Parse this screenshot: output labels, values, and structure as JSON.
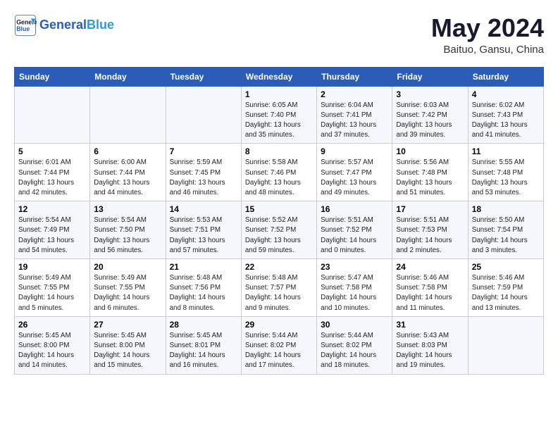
{
  "header": {
    "logo_line1": "General",
    "logo_line2": "Blue",
    "month": "May 2024",
    "location": "Baituo, Gansu, China"
  },
  "weekdays": [
    "Sunday",
    "Monday",
    "Tuesday",
    "Wednesday",
    "Thursday",
    "Friday",
    "Saturday"
  ],
  "weeks": [
    [
      {
        "day": "",
        "info": ""
      },
      {
        "day": "",
        "info": ""
      },
      {
        "day": "",
        "info": ""
      },
      {
        "day": "1",
        "info": "Sunrise: 6:05 AM\nSunset: 7:40 PM\nDaylight: 13 hours\nand 35 minutes."
      },
      {
        "day": "2",
        "info": "Sunrise: 6:04 AM\nSunset: 7:41 PM\nDaylight: 13 hours\nand 37 minutes."
      },
      {
        "day": "3",
        "info": "Sunrise: 6:03 AM\nSunset: 7:42 PM\nDaylight: 13 hours\nand 39 minutes."
      },
      {
        "day": "4",
        "info": "Sunrise: 6:02 AM\nSunset: 7:43 PM\nDaylight: 13 hours\nand 41 minutes."
      }
    ],
    [
      {
        "day": "5",
        "info": "Sunrise: 6:01 AM\nSunset: 7:44 PM\nDaylight: 13 hours\nand 42 minutes."
      },
      {
        "day": "6",
        "info": "Sunrise: 6:00 AM\nSunset: 7:44 PM\nDaylight: 13 hours\nand 44 minutes."
      },
      {
        "day": "7",
        "info": "Sunrise: 5:59 AM\nSunset: 7:45 PM\nDaylight: 13 hours\nand 46 minutes."
      },
      {
        "day": "8",
        "info": "Sunrise: 5:58 AM\nSunset: 7:46 PM\nDaylight: 13 hours\nand 48 minutes."
      },
      {
        "day": "9",
        "info": "Sunrise: 5:57 AM\nSunset: 7:47 PM\nDaylight: 13 hours\nand 49 minutes."
      },
      {
        "day": "10",
        "info": "Sunrise: 5:56 AM\nSunset: 7:48 PM\nDaylight: 13 hours\nand 51 minutes."
      },
      {
        "day": "11",
        "info": "Sunrise: 5:55 AM\nSunset: 7:48 PM\nDaylight: 13 hours\nand 53 minutes."
      }
    ],
    [
      {
        "day": "12",
        "info": "Sunrise: 5:54 AM\nSunset: 7:49 PM\nDaylight: 13 hours\nand 54 minutes."
      },
      {
        "day": "13",
        "info": "Sunrise: 5:54 AM\nSunset: 7:50 PM\nDaylight: 13 hours\nand 56 minutes."
      },
      {
        "day": "14",
        "info": "Sunrise: 5:53 AM\nSunset: 7:51 PM\nDaylight: 13 hours\nand 57 minutes."
      },
      {
        "day": "15",
        "info": "Sunrise: 5:52 AM\nSunset: 7:52 PM\nDaylight: 13 hours\nand 59 minutes."
      },
      {
        "day": "16",
        "info": "Sunrise: 5:51 AM\nSunset: 7:52 PM\nDaylight: 14 hours\nand 0 minutes."
      },
      {
        "day": "17",
        "info": "Sunrise: 5:51 AM\nSunset: 7:53 PM\nDaylight: 14 hours\nand 2 minutes."
      },
      {
        "day": "18",
        "info": "Sunrise: 5:50 AM\nSunset: 7:54 PM\nDaylight: 14 hours\nand 3 minutes."
      }
    ],
    [
      {
        "day": "19",
        "info": "Sunrise: 5:49 AM\nSunset: 7:55 PM\nDaylight: 14 hours\nand 5 minutes."
      },
      {
        "day": "20",
        "info": "Sunrise: 5:49 AM\nSunset: 7:55 PM\nDaylight: 14 hours\nand 6 minutes."
      },
      {
        "day": "21",
        "info": "Sunrise: 5:48 AM\nSunset: 7:56 PM\nDaylight: 14 hours\nand 8 minutes."
      },
      {
        "day": "22",
        "info": "Sunrise: 5:48 AM\nSunset: 7:57 PM\nDaylight: 14 hours\nand 9 minutes."
      },
      {
        "day": "23",
        "info": "Sunrise: 5:47 AM\nSunset: 7:58 PM\nDaylight: 14 hours\nand 10 minutes."
      },
      {
        "day": "24",
        "info": "Sunrise: 5:46 AM\nSunset: 7:58 PM\nDaylight: 14 hours\nand 11 minutes."
      },
      {
        "day": "25",
        "info": "Sunrise: 5:46 AM\nSunset: 7:59 PM\nDaylight: 14 hours\nand 13 minutes."
      }
    ],
    [
      {
        "day": "26",
        "info": "Sunrise: 5:45 AM\nSunset: 8:00 PM\nDaylight: 14 hours\nand 14 minutes."
      },
      {
        "day": "27",
        "info": "Sunrise: 5:45 AM\nSunset: 8:00 PM\nDaylight: 14 hours\nand 15 minutes."
      },
      {
        "day": "28",
        "info": "Sunrise: 5:45 AM\nSunset: 8:01 PM\nDaylight: 14 hours\nand 16 minutes."
      },
      {
        "day": "29",
        "info": "Sunrise: 5:44 AM\nSunset: 8:02 PM\nDaylight: 14 hours\nand 17 minutes."
      },
      {
        "day": "30",
        "info": "Sunrise: 5:44 AM\nSunset: 8:02 PM\nDaylight: 14 hours\nand 18 minutes."
      },
      {
        "day": "31",
        "info": "Sunrise: 5:43 AM\nSunset: 8:03 PM\nDaylight: 14 hours\nand 19 minutes."
      },
      {
        "day": "",
        "info": ""
      }
    ]
  ]
}
